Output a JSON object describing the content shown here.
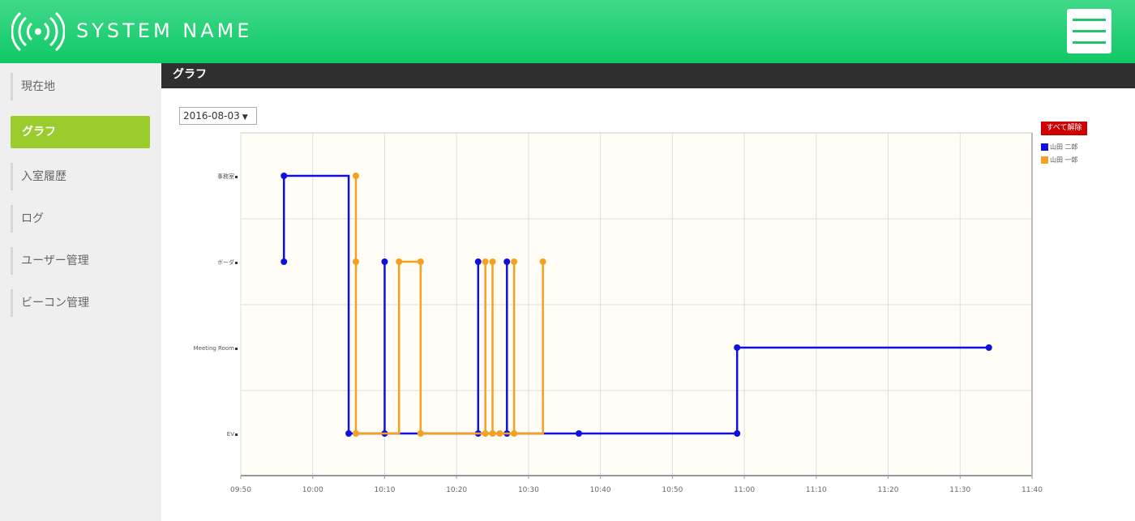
{
  "header": {
    "title": "SYSTEM NAME",
    "logo_icon": "wireless-signal-icon",
    "menu_icon": "hamburger-menu-icon"
  },
  "sidebar": {
    "items": [
      {
        "label": "現在地",
        "active": false
      },
      {
        "label": "グラフ",
        "active": true
      },
      {
        "label": "入室履歴",
        "active": false
      },
      {
        "label": "ログ",
        "active": false
      },
      {
        "label": "ユーザー管理",
        "active": false
      },
      {
        "label": "ビーコン管理",
        "active": false
      }
    ]
  },
  "page": {
    "title": "グラフ"
  },
  "date_select": {
    "value": "2016-08-03"
  },
  "controls": {
    "clear_all_label": "すべて解除"
  },
  "legend": {
    "items": [
      {
        "label": "山田 二郎",
        "color": "#1010dd"
      },
      {
        "label": "山田 一郎",
        "color": "#f5a020"
      }
    ]
  },
  "colors": {
    "accent": "#10c865",
    "active_nav": "#9bcc2e",
    "plot_background": "#fffdf5",
    "clear_button": "#cc0000"
  },
  "chart_data": {
    "type": "line",
    "step": "after",
    "x_type": "time",
    "xlim": [
      "09:50",
      "11:40"
    ],
    "x_ticks": [
      "09:50",
      "10:00",
      "10:10",
      "10:20",
      "10:30",
      "10:40",
      "10:50",
      "11:00",
      "11:10",
      "11:20",
      "11:30",
      "11:40"
    ],
    "y_categories": [
      "EV",
      "Meeting Room",
      "ボーダ",
      "事務室"
    ],
    "y_tick_labels": [
      "事務室",
      "ボーダ",
      "Meeting Room",
      "EV"
    ],
    "grid": true,
    "legend_position": "right",
    "series": [
      {
        "name": "山田 二郎",
        "color": "#1010dd",
        "points": [
          {
            "x": "09:56",
            "y": "ボーダ"
          },
          {
            "x": "09:56",
            "y": "事務室"
          },
          {
            "x": "10:05",
            "y": "EV"
          },
          {
            "x": "10:10",
            "y": "ボーダ"
          },
          {
            "x": "10:10",
            "y": "EV"
          },
          {
            "x": "10:23",
            "y": "ボーダ"
          },
          {
            "x": "10:23",
            "y": "EV"
          },
          {
            "x": "10:27",
            "y": "ボーダ"
          },
          {
            "x": "10:27",
            "y": "EV"
          },
          {
            "x": "10:37",
            "y": "EV"
          },
          {
            "x": "10:59",
            "y": "EV"
          },
          {
            "x": "10:59",
            "y": "Meeting Room"
          },
          {
            "x": "11:34",
            "y": "Meeting Room"
          }
        ]
      },
      {
        "name": "山田 一郎",
        "color": "#f5a020",
        "points": [
          {
            "x": "10:06",
            "y": "事務室"
          },
          {
            "x": "10:06",
            "y": "ボーダ"
          },
          {
            "x": "10:06",
            "y": "EV"
          },
          {
            "x": "10:12",
            "y": "ボーダ"
          },
          {
            "x": "10:15",
            "y": "ボーダ"
          },
          {
            "x": "10:15",
            "y": "EV"
          },
          {
            "x": "10:24",
            "y": "ボーダ"
          },
          {
            "x": "10:24",
            "y": "EV"
          },
          {
            "x": "10:25",
            "y": "ボーダ"
          },
          {
            "x": "10:25",
            "y": "EV"
          },
          {
            "x": "10:26",
            "y": "EV"
          },
          {
            "x": "10:28",
            "y": "ボーダ"
          },
          {
            "x": "10:28",
            "y": "EV"
          },
          {
            "x": "10:32",
            "y": "ボーダ"
          }
        ]
      }
    ]
  }
}
